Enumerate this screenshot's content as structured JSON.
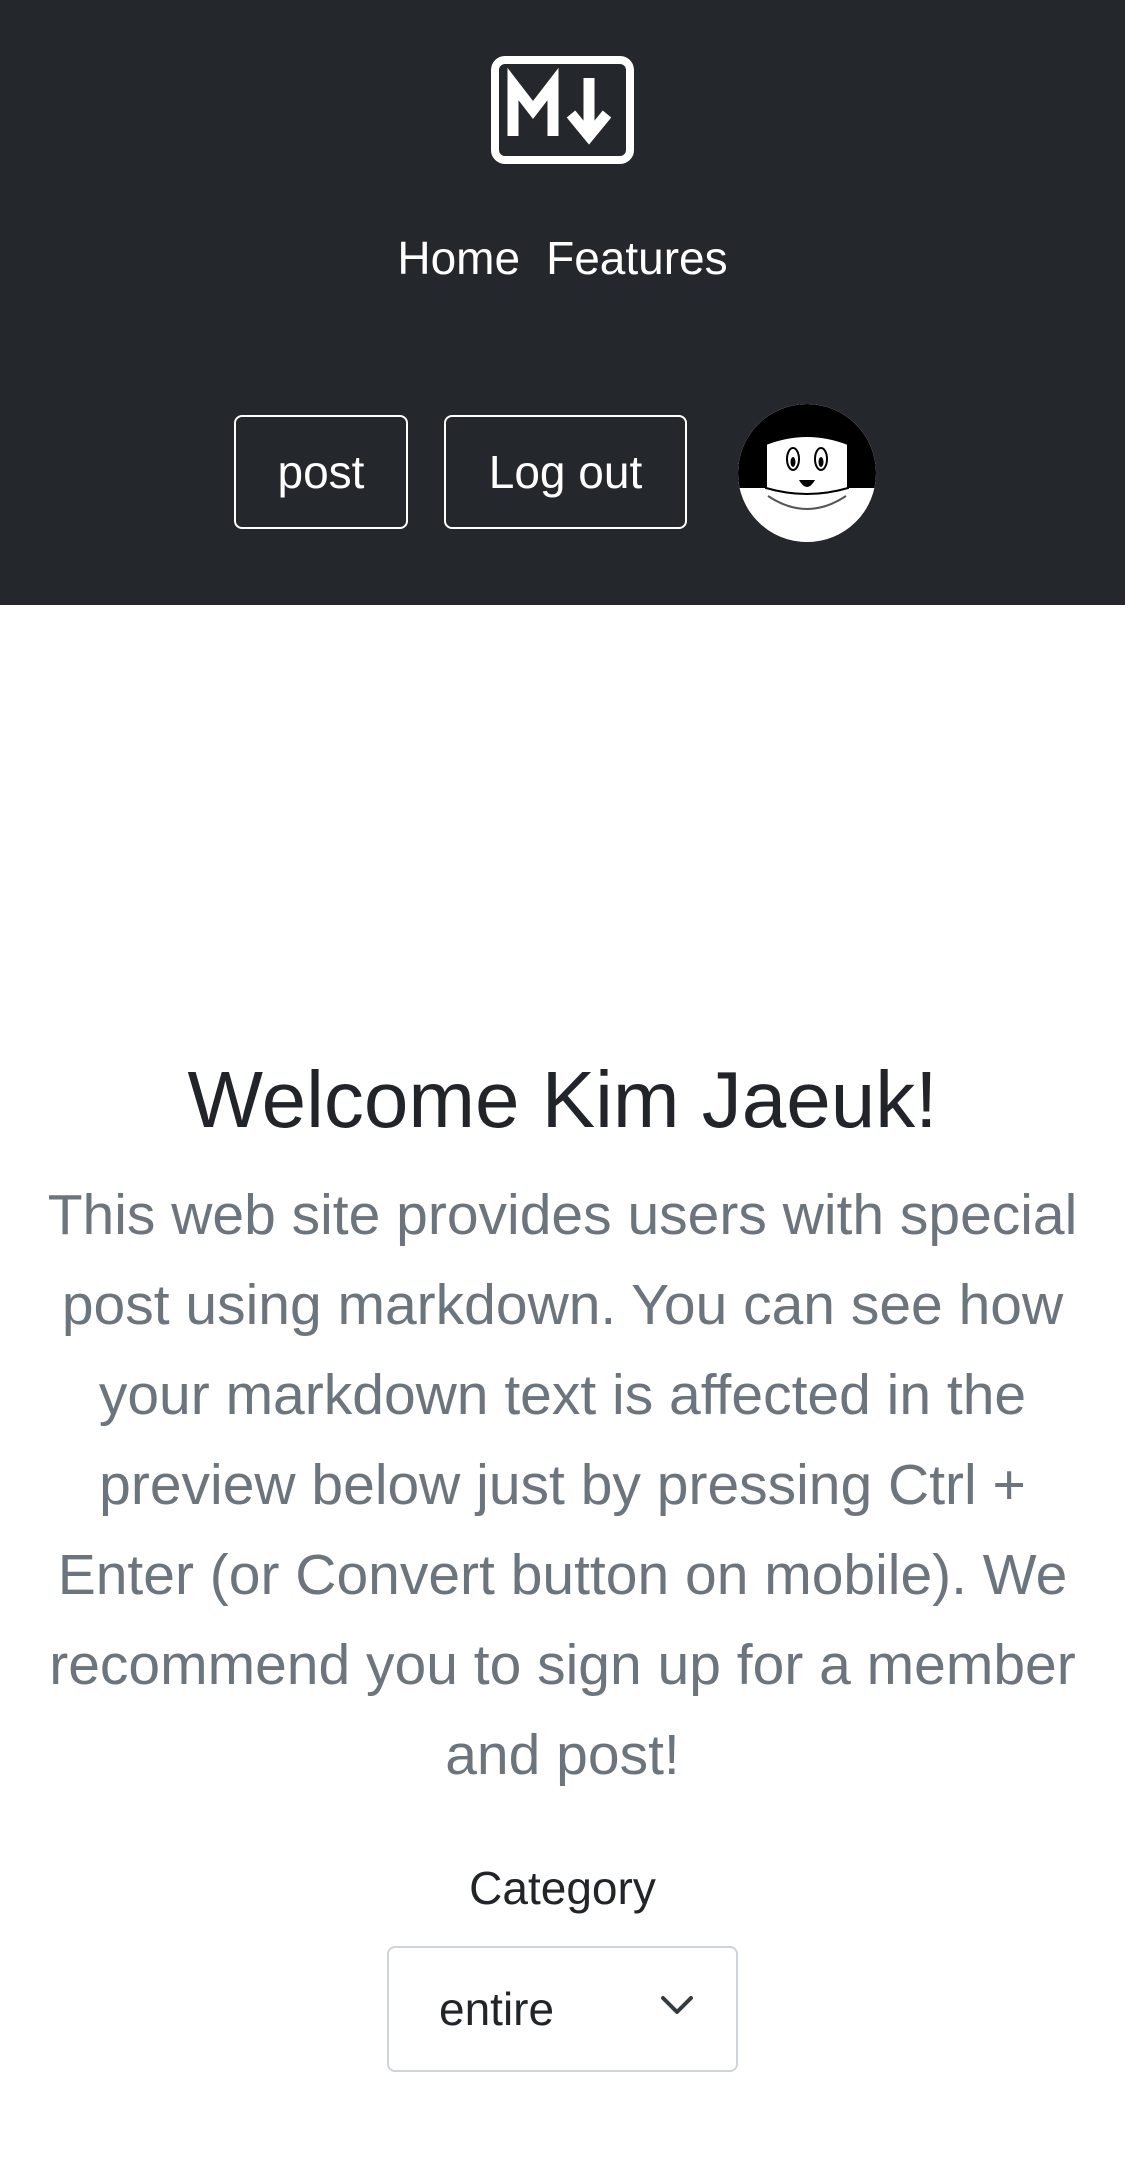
{
  "header": {
    "logo_icon": "markdown-icon",
    "nav": [
      {
        "label": "Home"
      },
      {
        "label": "Features"
      }
    ],
    "post_button": "post",
    "logout_button": "Log out",
    "avatar_icon": "user-avatar",
    "background": "#24272b"
  },
  "main": {
    "title": "Welcome Kim Jaeuk!",
    "lead": "This web site provides users with special post using markdown. You can see how your markdown text is affected in the preview below just by pressing Ctrl + Enter (or Convert button on mobile). We recommend you to sign up for a member and post!",
    "category_label": "Category",
    "category_select": {
      "selected": "entire",
      "icon": "chevron-down-icon"
    }
  }
}
